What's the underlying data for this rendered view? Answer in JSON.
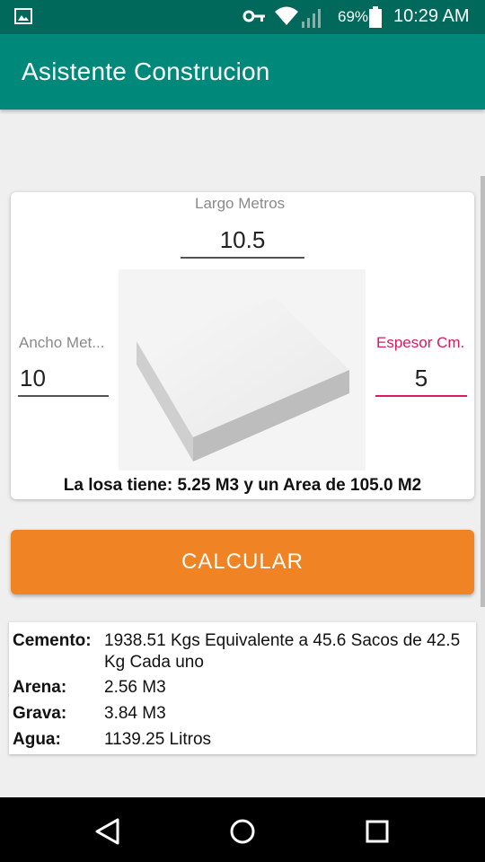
{
  "status_bar": {
    "battery_percent": "69%",
    "time": "10:29 AM",
    "icons": [
      "image-icon",
      "key-icon",
      "wifi-icon",
      "signal-icon",
      "battery-icon"
    ]
  },
  "app_bar": {
    "title": "Asistente Construcion"
  },
  "inputs": {
    "largo": {
      "label": "Largo Metros",
      "value": "10.5"
    },
    "ancho": {
      "label": "Ancho Met...",
      "value": "10"
    },
    "espesor": {
      "label": "Espesor Cm.",
      "value": "5"
    }
  },
  "summary": "La losa tiene: 5.25 M3 y un Area de 105.0 M2",
  "calc_button": {
    "label": "CALCULAR"
  },
  "results": [
    {
      "label": "Cemento:",
      "value": "1938.51 Kgs Equivalente a 45.6 Sacos de 42.5 Kg Cada uno"
    },
    {
      "label": "Arena:",
      "value": "2.56 M3"
    },
    {
      "label": "Grava:",
      "value": "3.84 M3"
    },
    {
      "label": "Agua:",
      "value": "1139.25 Litros"
    }
  ],
  "colors": {
    "status_bar": "#00695c",
    "app_bar": "#00897b",
    "button": "#f08424",
    "active_field": "#d81b60"
  },
  "nav_icons": [
    "back-icon",
    "home-icon",
    "recents-icon"
  ]
}
